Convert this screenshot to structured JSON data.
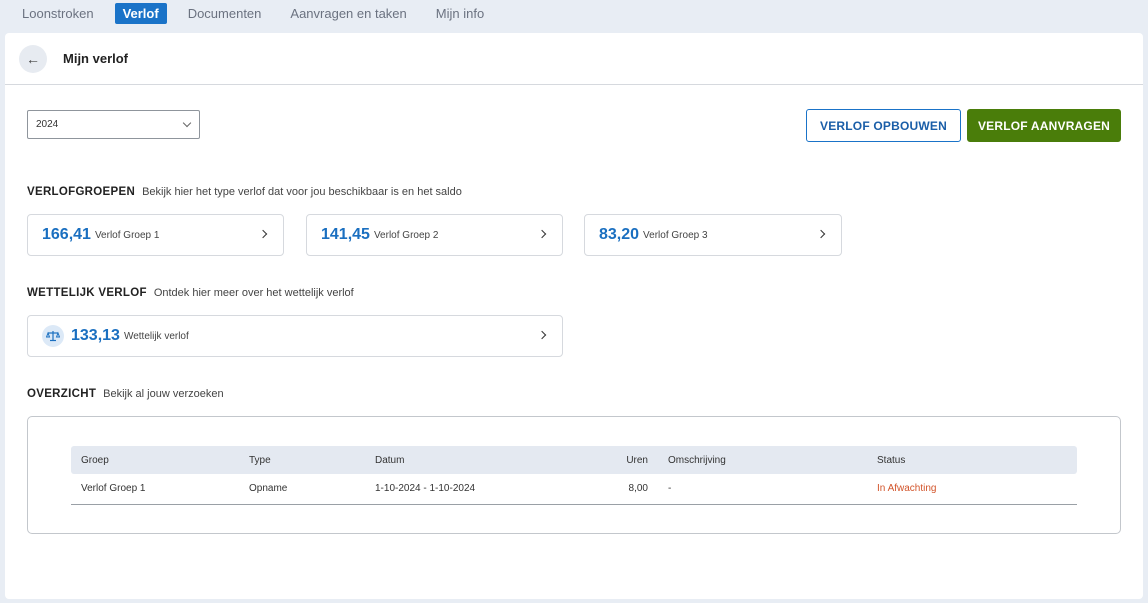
{
  "nav": {
    "tabs": [
      {
        "label": "Loonstroken",
        "active": false
      },
      {
        "label": "Verlof",
        "active": true
      },
      {
        "label": "Documenten",
        "active": false
      },
      {
        "label": "Aanvragen en taken",
        "active": false
      },
      {
        "label": "Mijn info",
        "active": false
      }
    ]
  },
  "header": {
    "back_icon": "arrow-left-icon",
    "title": "Mijn verlof"
  },
  "toolbar": {
    "year_value": "2024",
    "build_label": "VERLOF OPBOUWEN",
    "request_label": "VERLOF AANVRAGEN"
  },
  "groups": {
    "title": "VERLOFGROEPEN",
    "description": "Bekijk hier het type verlof dat voor jou beschikbaar is en het saldo",
    "items": [
      {
        "value": "166,41",
        "label": "Verlof Groep 1"
      },
      {
        "value": "141,45",
        "label": "Verlof Groep 2"
      },
      {
        "value": "83,20",
        "label": "Verlof Groep 3"
      }
    ]
  },
  "legal": {
    "title": "WETTELIJK VERLOF",
    "description": "Ontdek hier meer over het wettelijk verlof",
    "icon": "scale-icon",
    "value": "133,13",
    "label": "Wettelijk verlof"
  },
  "overview": {
    "title": "OVERZICHT",
    "description": "Bekijk al jouw verzoeken",
    "columns": [
      "Groep",
      "Type",
      "Datum",
      "Uren",
      "Omschrijving",
      "Status"
    ],
    "rows": [
      {
        "groep": "Verlof Groep 1",
        "type": "Opname",
        "datum": "1-10-2024 - 1-10-2024",
        "uren": "8,00",
        "omschrijving": "-",
        "status": "In Afwachting"
      }
    ]
  },
  "colors": {
    "accent": "#1a73c8",
    "primary_button": "#4a7d0a",
    "status_pending": "#d2542a"
  }
}
